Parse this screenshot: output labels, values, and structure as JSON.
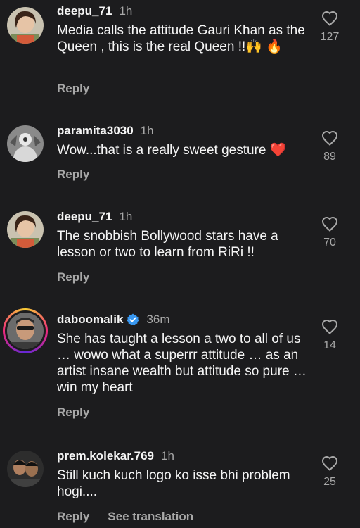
{
  "comments": [
    {
      "username": "deepu_71",
      "time": "1h",
      "text": "Media calls the attitude Gauri Khan as the Queen , this is the real Queen !!🙌 🔥",
      "reply": "Reply",
      "likes": "127",
      "verified": false
    },
    {
      "username": "paramita3030",
      "time": "1h",
      "text": "Wow...that is a really sweet gesture ❤️",
      "reply": "Reply",
      "likes": "89",
      "verified": false
    },
    {
      "username": "deepu_71",
      "time": "1h",
      "text": "The snobbish Bollywood stars have a lesson or two to learn from RiRi !!",
      "reply": "Reply",
      "likes": "70",
      "verified": false
    },
    {
      "username": "daboomalik",
      "time": "36m",
      "text": "She has taught a lesson a two to all of us … wowo what a superrr attitude … as an artist insane wealth but attitude so pure … win my heart",
      "reply": "Reply",
      "likes": "14",
      "verified": true
    },
    {
      "username": "prem.kolekar.769",
      "time": "1h",
      "text": "Still kuch kuch logo ko isse bhi problem hogi....",
      "reply": "Reply",
      "see_translation": "See translation",
      "likes": "25",
      "verified": false
    }
  ],
  "icons": {
    "like": "heart-outline-icon",
    "verified": "verified-badge-icon"
  },
  "colors": {
    "background": "#1c1c1e",
    "primary_text": "#f5f5f5",
    "secondary_text": "#a8a8a8",
    "verified_blue": "#3897f0"
  }
}
